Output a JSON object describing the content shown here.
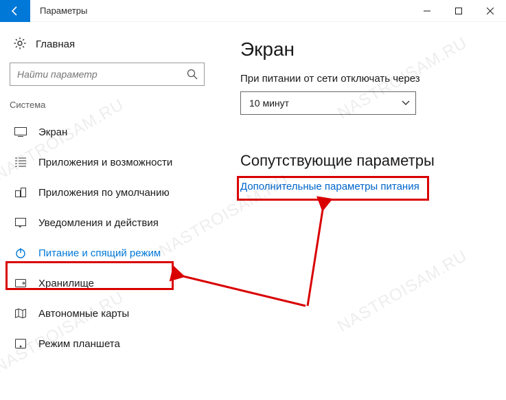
{
  "titlebar": {
    "title": "Параметры"
  },
  "sidebar": {
    "home_label": "Главная",
    "search_placeholder": "Найти параметр",
    "section_label": "Система",
    "items": [
      {
        "label": "Экран"
      },
      {
        "label": "Приложения и возможности"
      },
      {
        "label": "Приложения по умолчанию"
      },
      {
        "label": "Уведомления и действия"
      },
      {
        "label": "Питание и спящий режим"
      },
      {
        "label": "Хранилище"
      },
      {
        "label": "Автономные карты"
      },
      {
        "label": "Режим планшета"
      }
    ]
  },
  "main": {
    "heading": "Экран",
    "timeout_label": "При питании от сети отключать через",
    "timeout_value": "10 минут",
    "related_heading": "Сопутствующие параметры",
    "related_link": "Дополнительные параметры питания"
  },
  "watermark_text": "NASTROISAM.RU"
}
